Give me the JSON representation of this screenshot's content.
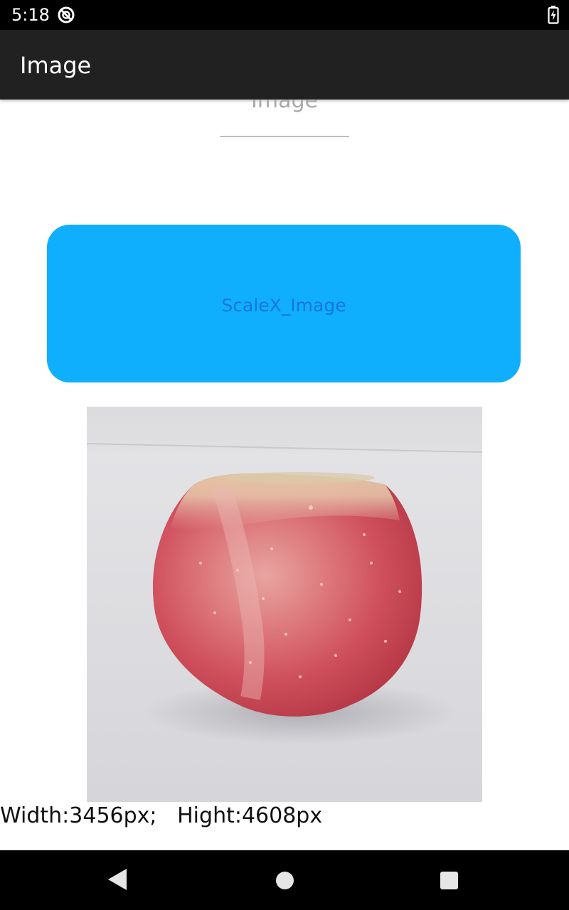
{
  "status_bar": {
    "time": "5:18",
    "sync_icon": "sync-disabled-icon",
    "battery_icon": "battery-charging-icon"
  },
  "app_bar": {
    "title": "Image"
  },
  "edit_field": {
    "hint": "Image"
  },
  "action_button": {
    "label": "ScaleX_Image",
    "background_color": "#0faffd",
    "text_color": "#1677d8"
  },
  "photo": {
    "subject": "apple-photo"
  },
  "dimension_text": "Width:3456px;   Hight:4608px",
  "nav_bar": {
    "back_icon": "back-triangle-icon",
    "home_icon": "home-circle-icon",
    "recents_icon": "recents-square-icon"
  }
}
